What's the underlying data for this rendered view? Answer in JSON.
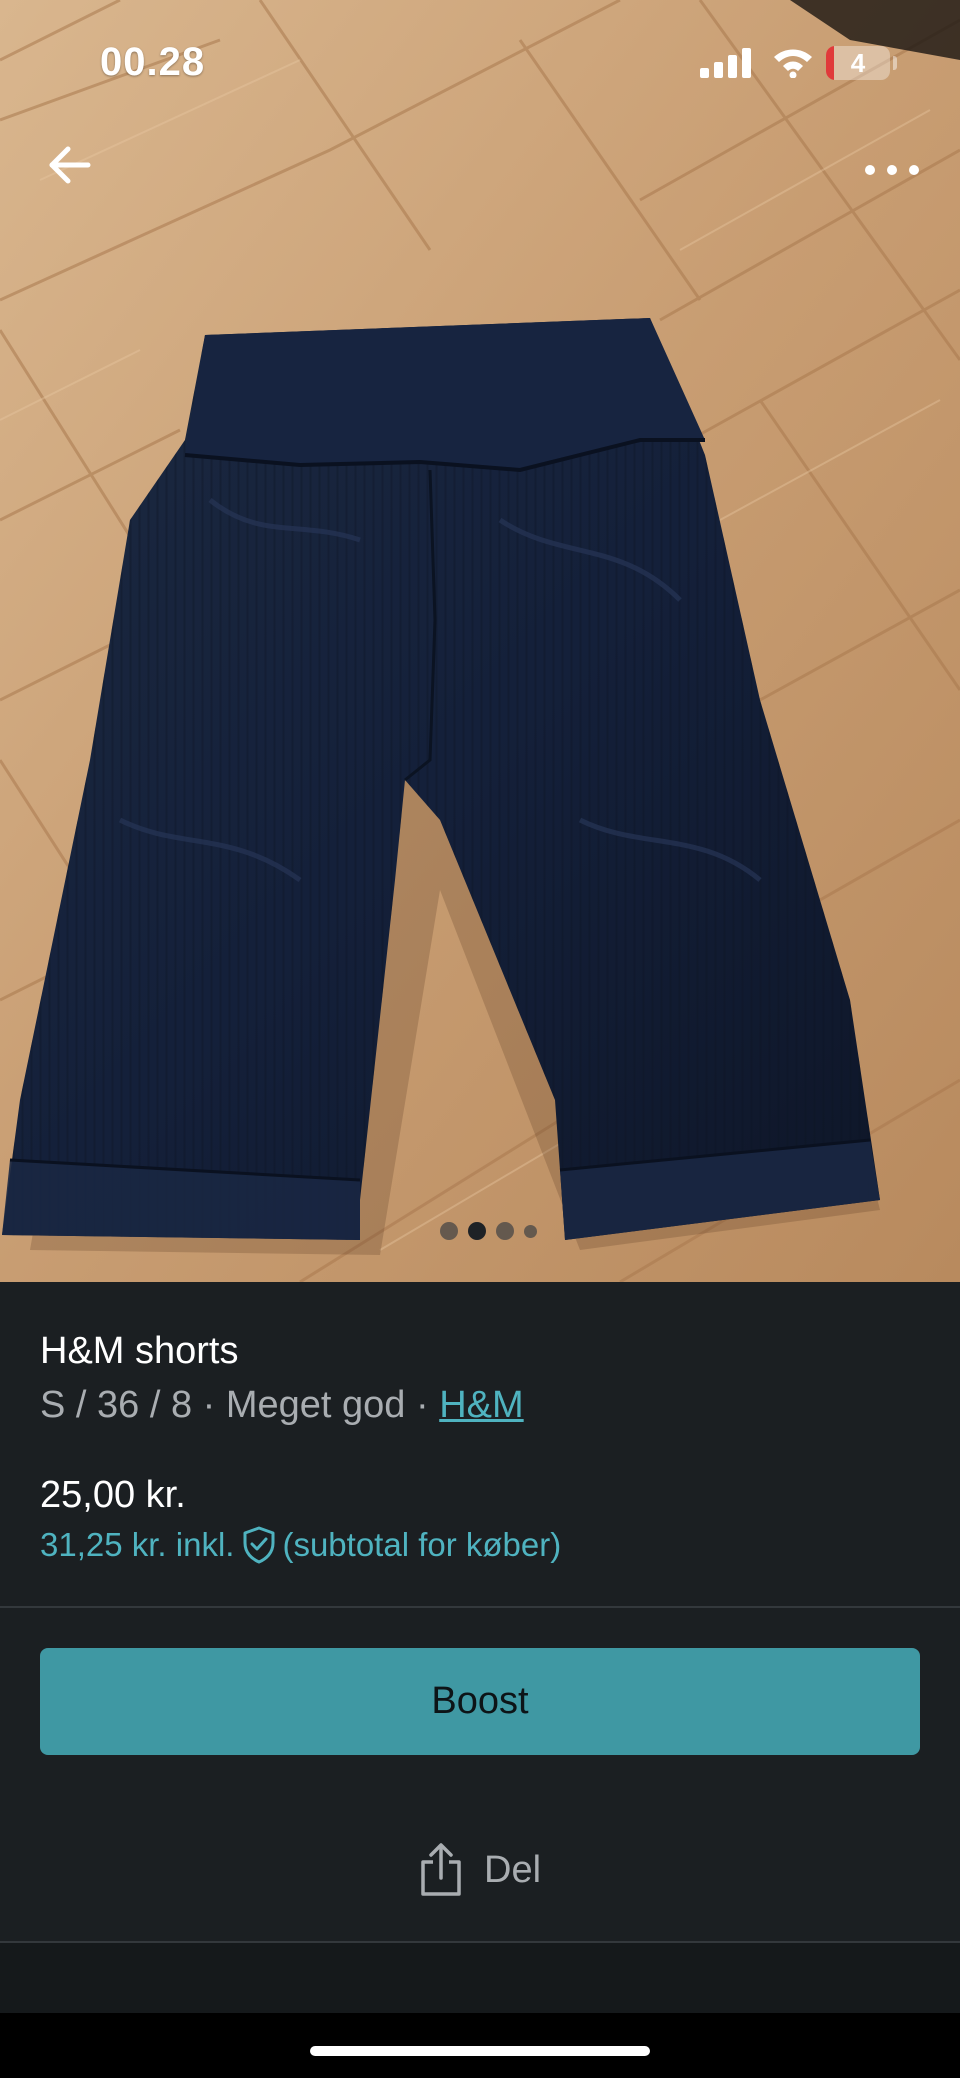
{
  "status_bar": {
    "time": "00.28",
    "battery_level": "4",
    "battery_fraction": 0.04
  },
  "photo": {
    "subject": "black ribbed biker shorts on wooden floor",
    "image_count": 4,
    "active_index": 1
  },
  "listing": {
    "title": "H&M shorts",
    "size_condition": "S / 36 / 8 · Meget god · ",
    "brand": "H&M",
    "price": "25,00 kr.",
    "price_incl_prefix": "31,25 kr. inkl.",
    "price_incl_suffix": "(subtotal for køber)"
  },
  "actions": {
    "boost_label": "Boost",
    "share_label": "Del"
  },
  "colors": {
    "accent": "#3f98a3",
    "link": "#4fb3c0",
    "background": "#1b1f22",
    "battery_low": "#e03a3a"
  },
  "icons": {
    "back": "arrow-left-icon",
    "more": "more-dots-icon",
    "signal": "cellular-signal-icon",
    "wifi": "wifi-icon",
    "battery": "battery-icon",
    "buyer_protection": "shield-check-icon",
    "share": "share-icon"
  }
}
